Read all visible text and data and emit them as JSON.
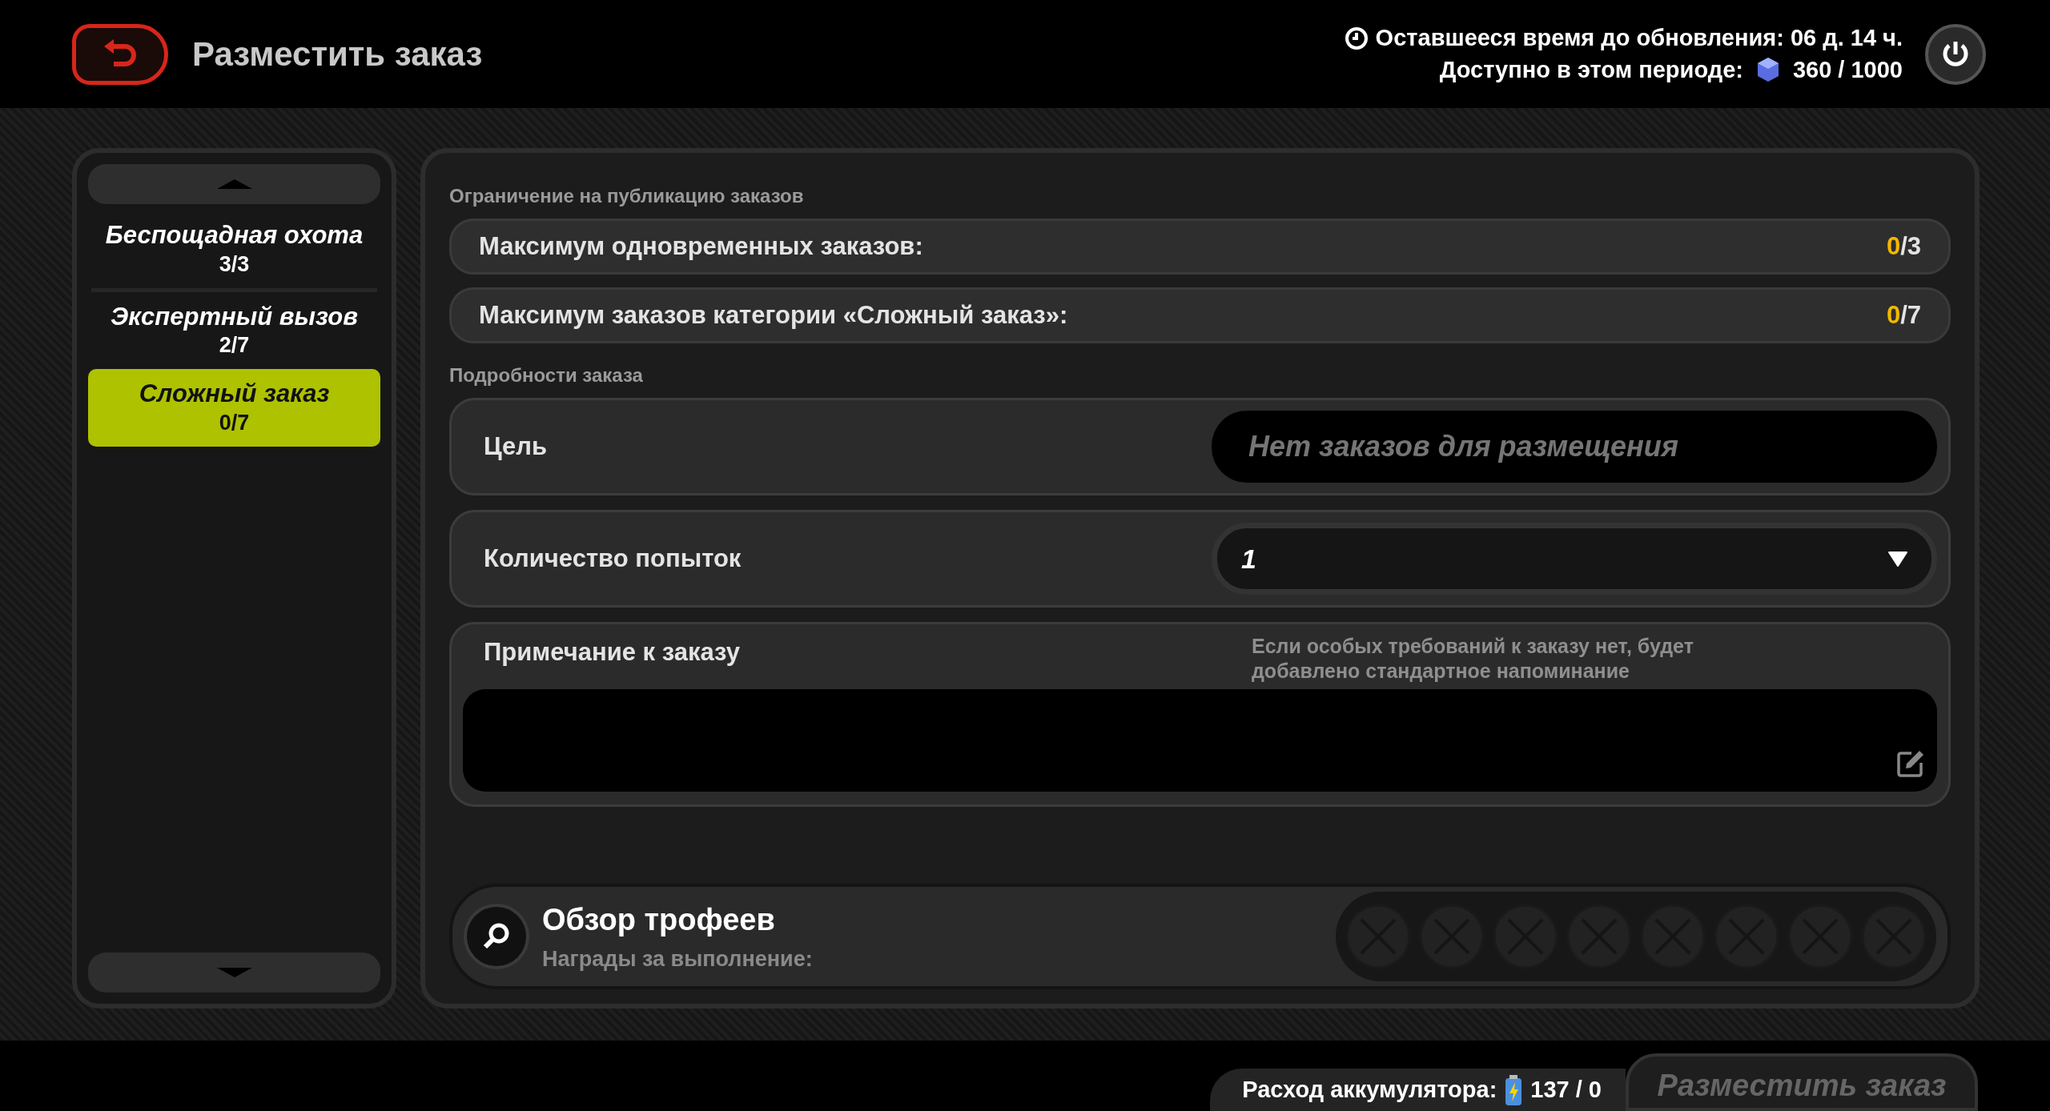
{
  "header": {
    "title": "Разместить заказ",
    "timer": "Оставшееся время до обновления: 06 д. 14 ч.",
    "available_label": "Доступно в этом периоде:",
    "available_value": "360 / 1000"
  },
  "sidebar": {
    "items": [
      {
        "title": "Беспощадная охота",
        "count": "3/3",
        "selected": false
      },
      {
        "title": "Экспертный вызов",
        "count": "2/7",
        "selected": false
      },
      {
        "title": "Сложный заказ",
        "count": "0/7",
        "selected": true
      }
    ]
  },
  "limits": {
    "heading": "Ограничение на публикацию заказов",
    "rows": [
      {
        "label": "Максимум одновременных заказов:",
        "current": "0",
        "max": "/3"
      },
      {
        "label": "Максимум заказов категории «Сложный заказ»:",
        "current": "0",
        "max": "/7"
      }
    ]
  },
  "details": {
    "heading": "Подробности заказа",
    "target": {
      "label": "Цель",
      "placeholder": "Нет заказов для размещения"
    },
    "attempts": {
      "label": "Количество попыток",
      "value": "1"
    },
    "note": {
      "label": "Примечание к заказу",
      "hint": "Если особых требований к заказу нет, будет добавлено стандартное напоминание"
    }
  },
  "trophies": {
    "title": "Обзор трофеев",
    "subtitle": "Награды за выполнение:",
    "slots": [
      {
        "kind": "empty"
      },
      {
        "kind": "empty"
      },
      {
        "kind": "empty"
      },
      {
        "kind": "empty"
      },
      {
        "kind": "empty"
      },
      {
        "kind": "empty"
      },
      {
        "kind": "empty"
      },
      {
        "kind": "empty"
      }
    ]
  },
  "footer": {
    "battery_label": "Расход аккумулятора:",
    "battery_value": "137 / 0",
    "submit": {
      "label": "Разместить заказ",
      "disabled": true
    }
  }
}
